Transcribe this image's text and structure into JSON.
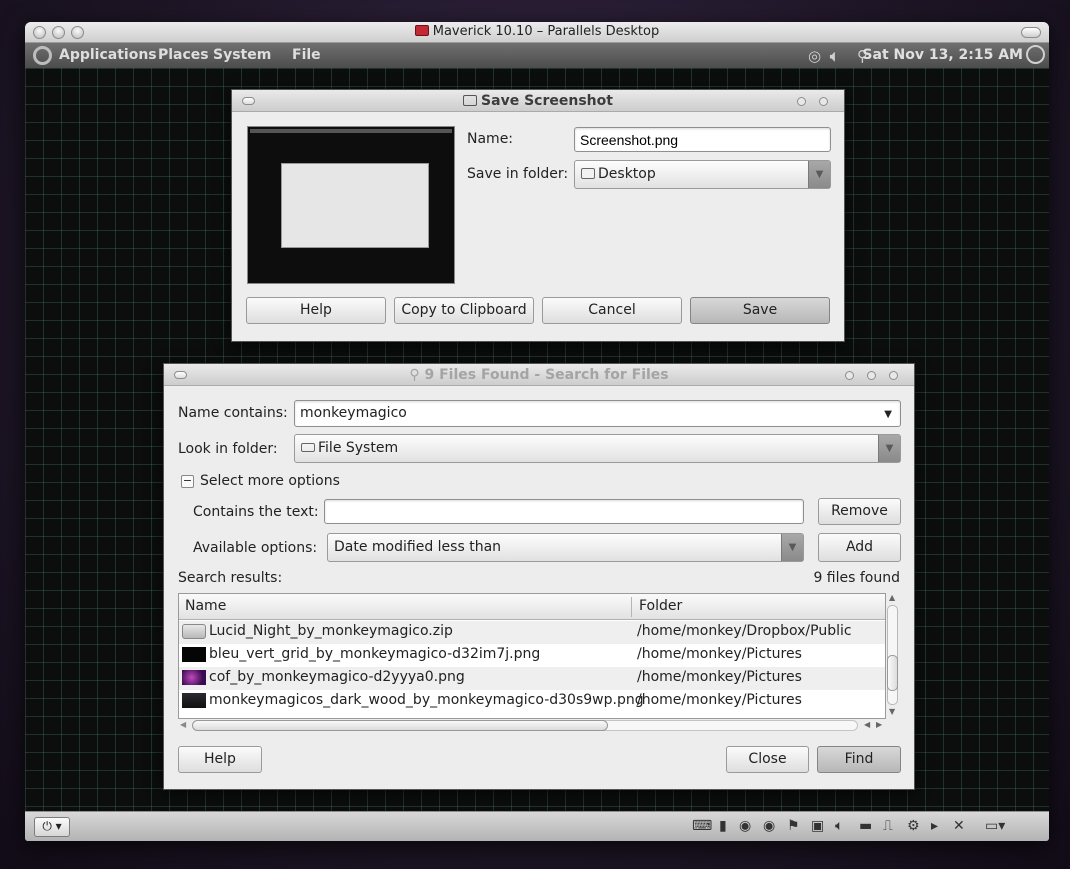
{
  "mac": {
    "title": "Maverick 10.10 – Parallels Desktop"
  },
  "panel": {
    "menus": [
      "Applications",
      "Places",
      "System",
      "File"
    ],
    "clock": "Sat Nov 13,  2:15 AM"
  },
  "save_dialog": {
    "title": "Save Screenshot",
    "name_label": "Name:",
    "name_value": "Screenshot.png",
    "folder_label": "Save in folder:",
    "folder_value": "Desktop",
    "buttons": {
      "help": "Help",
      "copy": "Copy to Clipboard",
      "cancel": "Cancel",
      "save": "Save"
    }
  },
  "search_dialog": {
    "title": "9 Files Found - Search for Files",
    "name_contains_label": "Name contains:",
    "name_contains_value": "monkeymagico",
    "look_in_label": "Look in folder:",
    "look_in_value": "File System",
    "more_options_label": "Select more options",
    "contains_text_label": "Contains the text:",
    "contains_text_value": "",
    "remove_label": "Remove",
    "available_label": "Available options:",
    "available_value": "Date modified less than",
    "add_label": "Add",
    "search_results_label": "Search results:",
    "files_found": "9 files found",
    "columns": {
      "name": "Name",
      "folder": "Folder"
    },
    "rows": [
      {
        "name": "Lucid_Night_by_monkeymagico.zip",
        "folder": "/home/monkey/Dropbox/Public",
        "icon": "archive-icon"
      },
      {
        "name": "bleu_vert_grid_by_monkeymagico-d32im7j.png",
        "folder": "/home/monkey/Pictures",
        "icon": "image-thumb-black"
      },
      {
        "name": "cof_by_monkeymagico-d2yyya0.png",
        "folder": "/home/monkey/Pictures",
        "icon": "image-thumb-purple"
      },
      {
        "name": "monkeymagicos_dark_wood_by_monkeymagico-d30s9wp.png",
        "folder": "/home/monkey/Pictures",
        "icon": "image-thumb-dark"
      }
    ],
    "buttons": {
      "help": "Help",
      "close": "Close",
      "find": "Find"
    }
  },
  "colors": {
    "desktop_bg": "#0b0e0d",
    "grid": "#3a6a58",
    "panel": "#5a5a5a"
  }
}
